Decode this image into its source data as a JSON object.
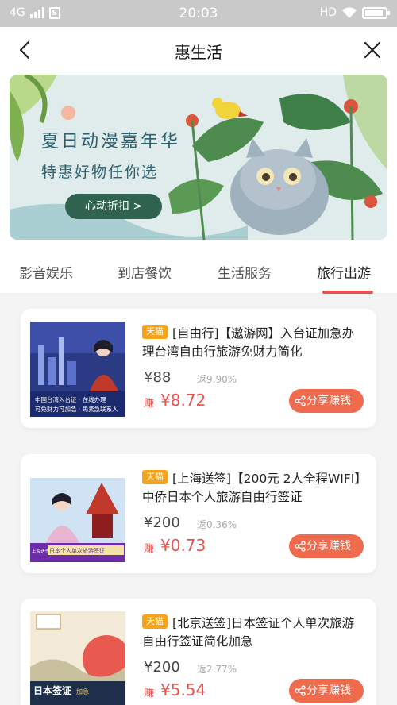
{
  "status_bar": {
    "network": "4G",
    "time": "20:03",
    "hd": "HD"
  },
  "nav": {
    "title": "惠生活"
  },
  "banner": {
    "headline": "夏日动漫嘉年华",
    "subline": "特惠好物任你选",
    "cta": "心动折扣 >"
  },
  "tabs": [
    {
      "label": "影音娱乐"
    },
    {
      "label": "到店餐饮"
    },
    {
      "label": "生活服务"
    },
    {
      "label": "旅行出游"
    }
  ],
  "active_tab": 3,
  "products": [
    {
      "tag": "天猫",
      "title": "[自由行]【遨游网】入台证加急办理台湾自由行旅游免财力简化",
      "price": "¥88",
      "rebate": "返9.90%",
      "earn_label": "赚",
      "earn": "¥8.72",
      "share": "分享赚钱",
      "thumb_caption": [
        "中国台湾入台证 · 在线办理",
        "可免财力可加急 · 免紧急联系人"
      ]
    },
    {
      "tag": "天猫",
      "title": "[上海送签]【200元 2人全程WIFI】中侨日本个人旅游自由行签证",
      "price": "¥200",
      "rebate": "返0.36%",
      "earn_label": "赚",
      "earn": "¥0.73",
      "share": "分享赚钱",
      "thumb_caption": [
        "日本个人单次旅游签证",
        "上海送签"
      ]
    },
    {
      "tag": "天猫",
      "title": "[北京送签]日本签证个人单次旅游自由行签证简化加急",
      "price": "¥200",
      "rebate": "返2.77%",
      "earn_label": "赚",
      "earn": "¥5.54",
      "share": "分享赚钱",
      "thumb_caption": [
        "日本签证",
        "加急"
      ]
    }
  ],
  "colors": {
    "accent": "#e9534c",
    "share": "#f06a4d",
    "tag": "#f7a31a",
    "banner_btn": "#2f6350"
  }
}
